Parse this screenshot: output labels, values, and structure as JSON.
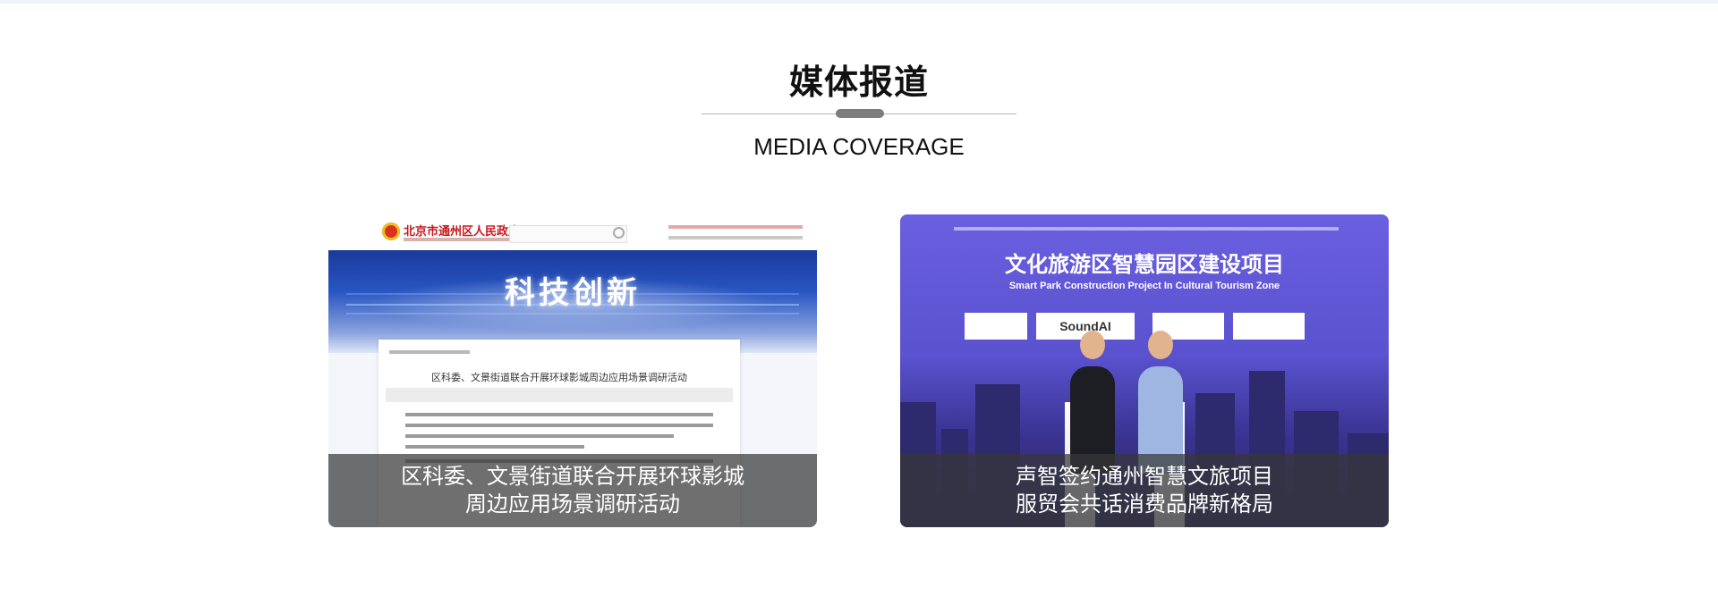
{
  "section": {
    "title": "媒体报道",
    "subtitle": "MEDIA COVERAGE"
  },
  "cards": [
    {
      "caption_line1": "区科委、文景街道联合开展环球影城",
      "caption_line2": "周边应用场景调研活动",
      "thumbnail": {
        "site_name": "北京市通州区人民政府",
        "banner_text": "科技创新",
        "article_heading": "区科委、文景街道联合开展环球影城周边应用场景调研活动"
      }
    },
    {
      "caption_line1": "声智签约通州智慧文旅项目",
      "caption_line2": "服贸会共话消费品牌新格局",
      "thumbnail": {
        "stage_title": "文化旅游区智慧园区建设项目",
        "stage_subtitle_en": "Smart Park Construction Project In Cultural Tourism Zone",
        "logo_soundai": "SoundAI"
      }
    }
  ],
  "colors": {
    "caption_overlay": "#373737",
    "divider_pill": "#7d7d7d",
    "divider_line": "#b5b5b5"
  }
}
